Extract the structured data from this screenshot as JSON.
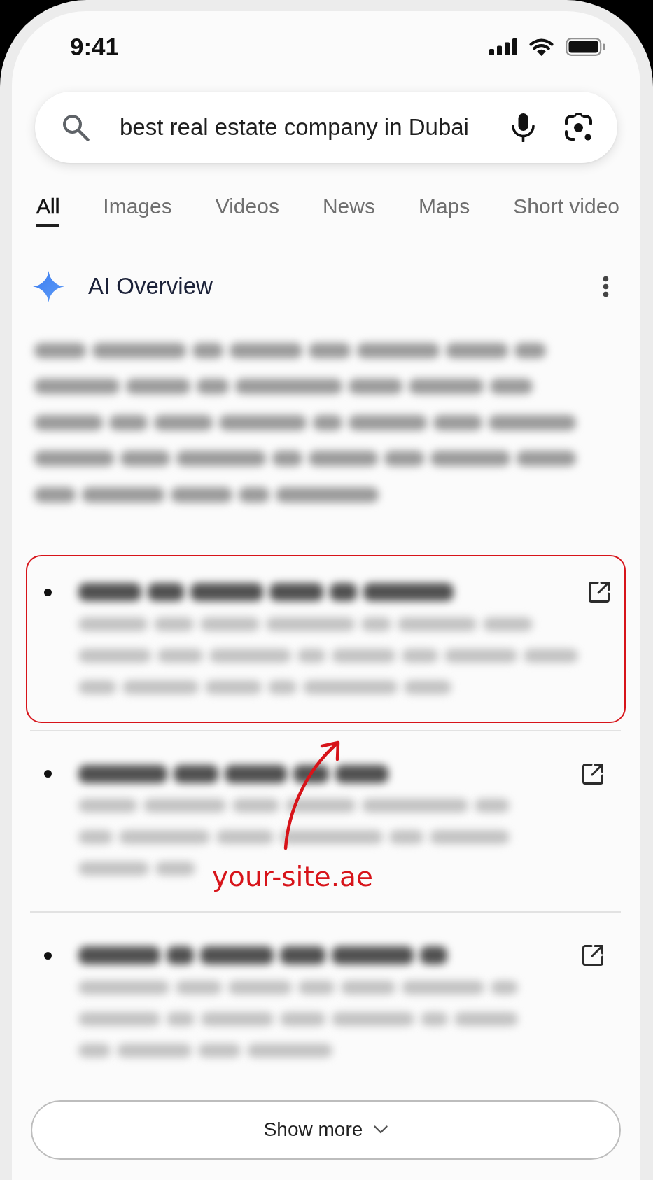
{
  "status_bar": {
    "time": "9:41"
  },
  "search": {
    "query": "best real estate company in Dubai"
  },
  "tabs": [
    {
      "label": "All",
      "selected": true
    },
    {
      "label": "Images",
      "selected": false
    },
    {
      "label": "Videos",
      "selected": false
    },
    {
      "label": "News",
      "selected": false
    },
    {
      "label": "Maps",
      "selected": false
    },
    {
      "label": "Short video",
      "selected": false
    }
  ],
  "ai_overview": {
    "title": "AI Overview",
    "results": [
      {
        "highlighted": true
      },
      {
        "highlighted": false
      },
      {
        "highlighted": false
      }
    ]
  },
  "annotation": {
    "label": "your-site.ae"
  },
  "show_more": {
    "label": "Show more"
  }
}
